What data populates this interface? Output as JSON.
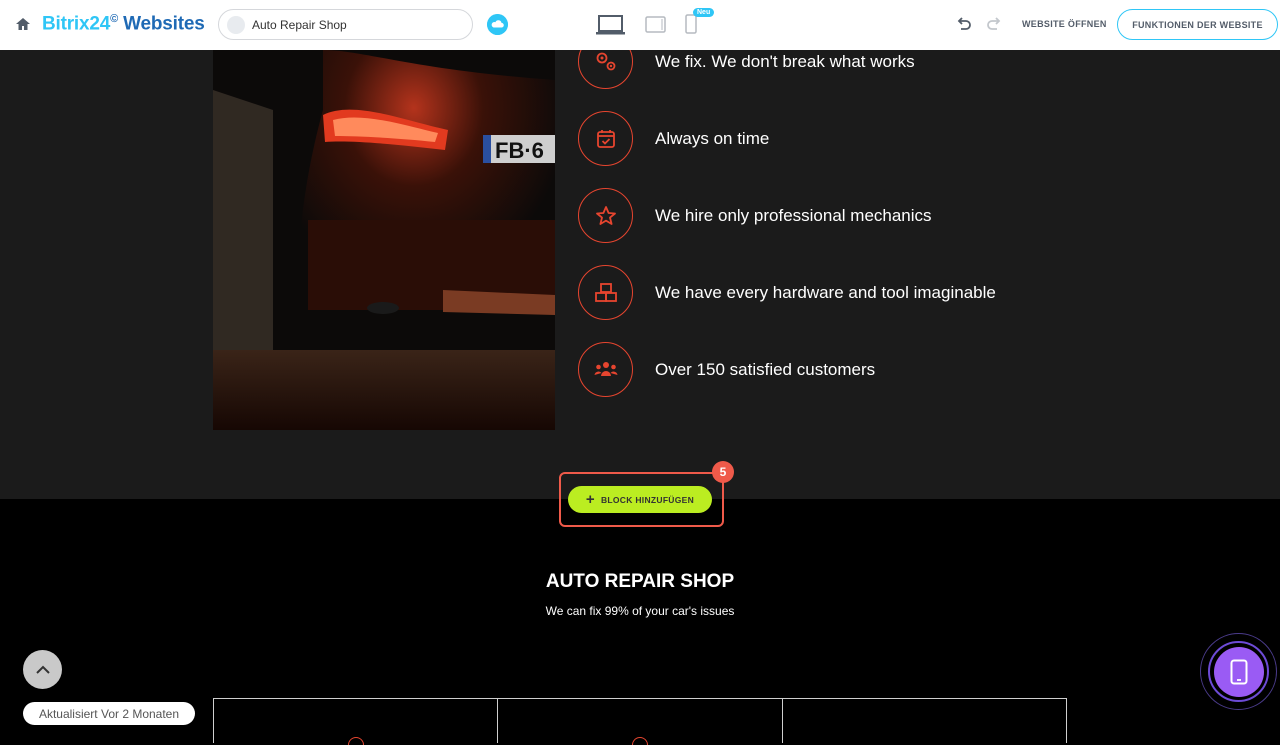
{
  "toolbar": {
    "brand_main": "Bitrix24",
    "brand_badge": "©",
    "brand_suffix": "Websites",
    "site_name": "Auto Repair Shop",
    "new_badge": "Neu",
    "open_site": "WEBSITE ÖFFNEN",
    "site_features": "FUNKTIONEN DER WEBSITE"
  },
  "features": [
    {
      "icon": "gears-icon",
      "text": "We fix. We don't break what works"
    },
    {
      "icon": "calendar-check-icon",
      "text": "Always on time"
    },
    {
      "icon": "star-icon",
      "text": "We hire only professional mechanics"
    },
    {
      "icon": "boxes-icon",
      "text": "We have every hardware and tool imaginable"
    },
    {
      "icon": "users-icon",
      "text": "Over 150 satisfied customers"
    }
  ],
  "add_block": {
    "label": "BLOCK HINZUFÜGEN",
    "step_badge": "5"
  },
  "next_section": {
    "title": "AUTO REPAIR SHOP",
    "subtitle": "We can fix 99% of your car's issues"
  },
  "footer": {
    "updated": "Aktualisiert Vor 2 Monaten"
  },
  "colors": {
    "accent": "#e6452f",
    "brand": "#2fc6f6",
    "add_button": "#bbed21",
    "highlight": "#ef5a4a"
  }
}
